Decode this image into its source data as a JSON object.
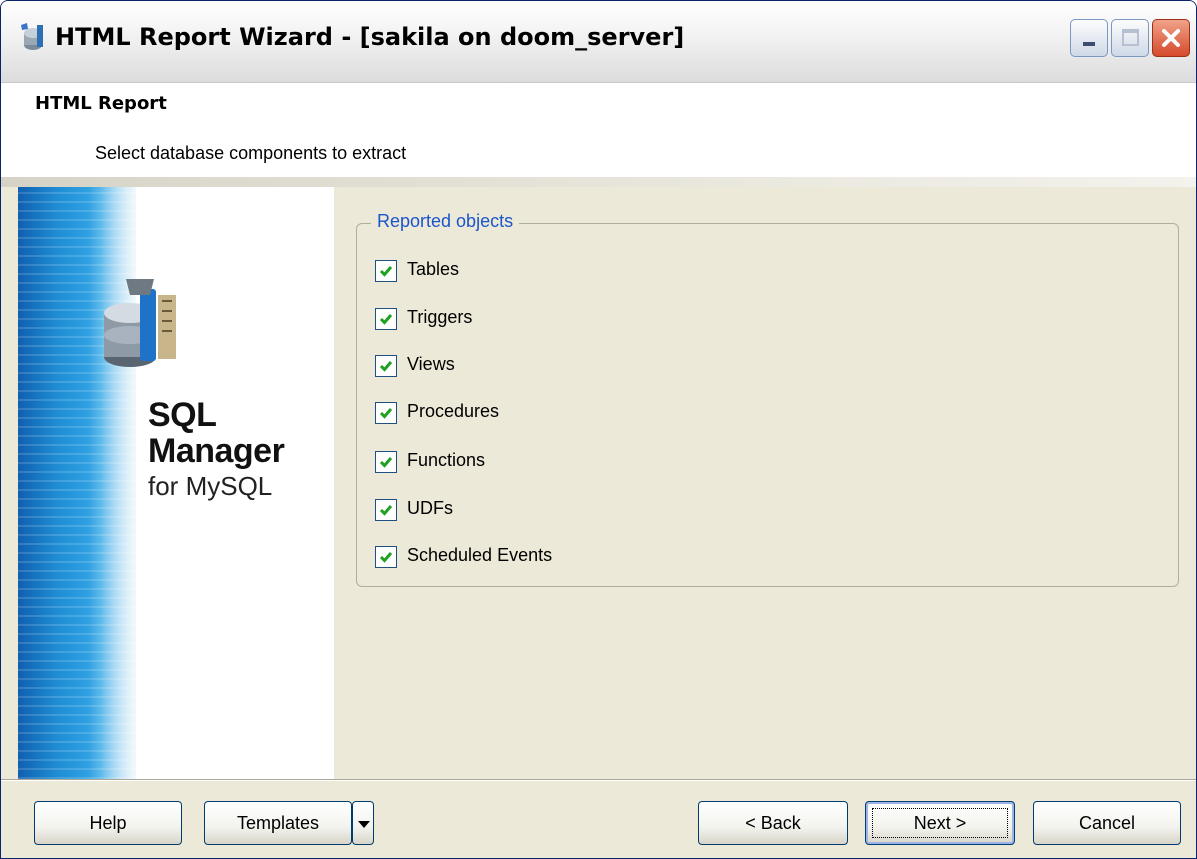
{
  "window": {
    "title": "HTML Report Wizard - [sakila on doom_server]",
    "controls": [
      "minimize-icon",
      "maximize-icon",
      "close-icon"
    ]
  },
  "header": {
    "title": "HTML Report",
    "subtitle": "Select database components to extract"
  },
  "banner": {
    "line1": "SQL",
    "line2": "Manager",
    "line3": "for MySQL"
  },
  "group": {
    "legend": "Reported objects",
    "options": [
      {
        "label": "Tables",
        "checked": true
      },
      {
        "label": "Triggers",
        "checked": true
      },
      {
        "label": "Views",
        "checked": true
      },
      {
        "label": "Procedures",
        "checked": true
      },
      {
        "label": "Functions",
        "checked": true
      },
      {
        "label": "UDFs",
        "checked": true
      },
      {
        "label": "Scheduled Events",
        "checked": true
      }
    ]
  },
  "buttons": {
    "help": "Help",
    "templates": "Templates",
    "back": "< Back",
    "next": "Next >",
    "cancel": "Cancel"
  },
  "colors": {
    "accent": "#1a55cc",
    "face": "#ece9d8"
  }
}
